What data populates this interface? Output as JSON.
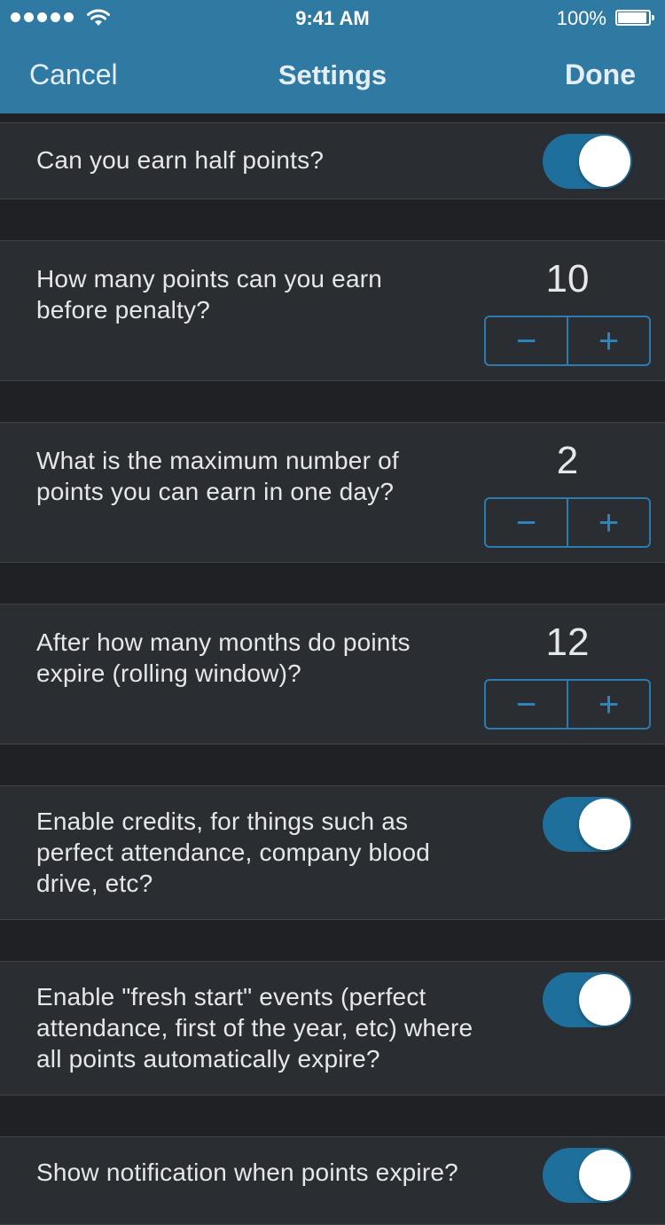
{
  "status_bar": {
    "time": "9:41 AM",
    "battery_percent": "100%",
    "icons": [
      "signal-dots-icon",
      "wifi-icon",
      "battery-icon"
    ]
  },
  "nav": {
    "cancel_label": "Cancel",
    "title": "Settings",
    "done_label": "Done"
  },
  "colors": {
    "nav_background": "#2e7aa3",
    "page_background": "#1f2125",
    "row_background": "#2a2d31",
    "toggle_on": "#1f6f9c",
    "stepper_accent": "#2a7bb0"
  },
  "settings": [
    {
      "label": "Can you earn half points?",
      "type": "toggle",
      "on": true
    },
    {
      "label_lines": [
        "How many points can you earn",
        "before penalty?"
      ],
      "type": "stepper",
      "value": "10",
      "minus": "−",
      "plus": "+"
    },
    {
      "label_lines": [
        "What is the maximum number of",
        "points you can earn in one day?"
      ],
      "type": "stepper",
      "value": "2",
      "minus": "−",
      "plus": "+"
    },
    {
      "label_lines": [
        "After how many months do points",
        "expire (rolling window)?"
      ],
      "type": "stepper",
      "value": "12",
      "minus": "−",
      "plus": "+"
    },
    {
      "label_lines": [
        "Enable credits, for things such as",
        "perfect attendance, company blood",
        "drive, etc?"
      ],
      "type": "toggle",
      "on": true
    },
    {
      "label_lines": [
        "Enable \"fresh start\" events (perfect",
        "attendance, first of the year, etc) where",
        "all points automatically expire?"
      ],
      "type": "toggle",
      "on": true
    },
    {
      "label": "Show notification when points expire?",
      "type": "toggle",
      "on": true
    }
  ]
}
